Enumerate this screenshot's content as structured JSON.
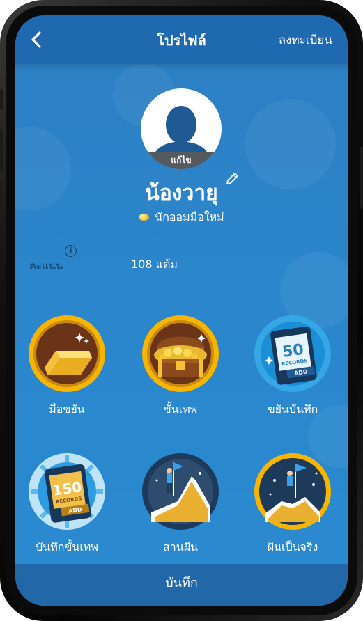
{
  "header": {
    "title": "โปรไฟล์",
    "register_label": "ลงทะเบียน"
  },
  "profile": {
    "edit_label": "แก้ไข",
    "name": "น้องวายุ",
    "rank": "นักออมมือใหม่"
  },
  "score": {
    "label": "คะแนน",
    "value": "108 แต้ม"
  },
  "badges": [
    {
      "label": "มือขยัน",
      "icon": "gold-bar-icon"
    },
    {
      "label": "ขั้นเทพ",
      "icon": "treasure-chest-icon"
    },
    {
      "label": "ขยันบันทึก",
      "icon": "50-records-icon",
      "number": "50",
      "caption": "RECORDS",
      "tag": "ADD"
    },
    {
      "label": "บันทึกขั้นเทพ",
      "icon": "150-records-icon",
      "number": "150",
      "caption": "RECORDS",
      "tag": "ADD"
    },
    {
      "label": "สานฝัน",
      "icon": "climber-flag-icon"
    },
    {
      "label": "ฝันเป็นจริง",
      "icon": "summit-flag-icon"
    }
  ],
  "footer": {
    "save_label": "บันทึก"
  },
  "colors": {
    "header": "#1f69b0",
    "screen": "#2b86cc",
    "footer": "#2268a8",
    "gold_ring": "#f5b400",
    "score_label": "#123d66"
  }
}
